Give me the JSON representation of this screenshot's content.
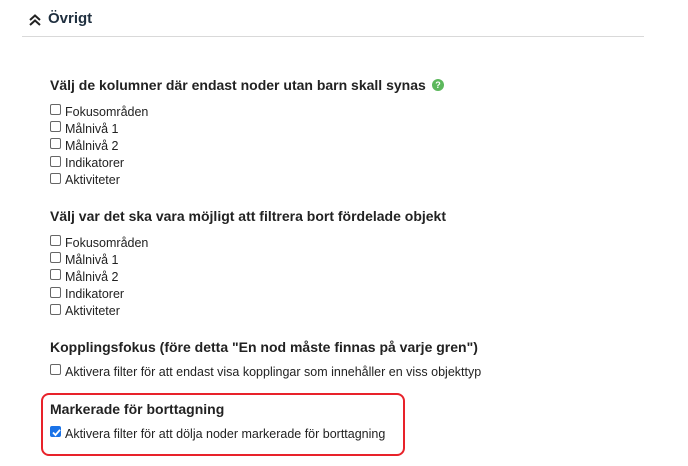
{
  "section": {
    "title": "Övrigt"
  },
  "group1": {
    "title": "Välj de kolumner där endast noder utan barn skall synas",
    "options": [
      "Fokusområden",
      "Målnivå 1",
      "Målnivå 2",
      "Indikatorer",
      "Aktiviteter"
    ]
  },
  "group2": {
    "title": "Välj var det ska vara möjligt att filtrera bort fördelade objekt",
    "options": [
      "Fokusområden",
      "Målnivå 1",
      "Målnivå 2",
      "Indikatorer",
      "Aktiviteter"
    ]
  },
  "group3": {
    "title": "Kopplingsfokus (före detta \"En nod måste finnas på varje gren\")",
    "option": "Aktivera filter för att endast visa kopplingar som innehåller en viss objekttyp"
  },
  "group4": {
    "title": "Markerade för borttagning",
    "option": "Aktivera filter för att dölja noder markerade för borttagning",
    "checked": true
  },
  "colors": {
    "highlight": "#e8222a",
    "help_icon": "#5cb85c",
    "checkbox_checked": "#1a73e8"
  },
  "icons": {
    "collapse": "double-chevron-up-icon",
    "help": "help-icon"
  }
}
